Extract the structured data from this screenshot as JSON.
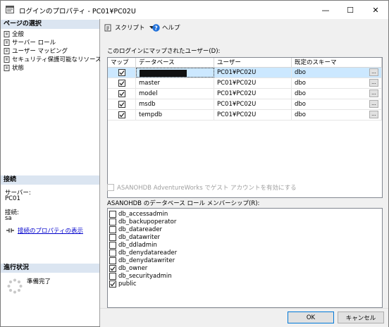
{
  "window": {
    "title": "ログインのプロパティ - PC01¥PC02U",
    "controls": {
      "minimize": "—",
      "maximize": "☐",
      "close": "✕"
    }
  },
  "sidebar": {
    "select_page_header": "ページの選択",
    "items": [
      {
        "label": "全般",
        "icon": "page-icon"
      },
      {
        "label": "サーバー ロール",
        "icon": "page-icon"
      },
      {
        "label": "ユーザー マッピング",
        "icon": "page-icon"
      },
      {
        "label": "セキュリティ保護可能なリソース",
        "icon": "page-icon"
      },
      {
        "label": "状態",
        "icon": "page-icon"
      }
    ],
    "connection_header": "接続",
    "server_label": "サーバー:",
    "server_value": "PC01",
    "connection_label": "接続:",
    "connection_value": "sa",
    "view_connection_link": "接続のプロパティの表示",
    "progress_header": "進行状況",
    "progress_status": "準備完了"
  },
  "toolbar": {
    "script_label": "スクリプト",
    "help_label": "ヘルプ"
  },
  "mapping": {
    "title": "このログインにマップされたユーザー(D):",
    "columns": [
      "マップ",
      "データベース",
      "ユーザー",
      "既定のスキーマ"
    ],
    "rows": [
      {
        "checked": true,
        "database": "",
        "redacted": true,
        "user": "PC01¥PC02U",
        "schema": "dbo",
        "selected": true
      },
      {
        "checked": true,
        "database": "master",
        "redacted": false,
        "user": "PC01¥PC02U",
        "schema": "dbo",
        "selected": false
      },
      {
        "checked": true,
        "database": "model",
        "redacted": false,
        "user": "PC01¥PC02U",
        "schema": "dbo",
        "selected": false
      },
      {
        "checked": true,
        "database": "msdb",
        "redacted": false,
        "user": "PC01¥PC02U",
        "schema": "dbo",
        "selected": false
      },
      {
        "checked": true,
        "database": "tempdb",
        "redacted": false,
        "user": "PC01¥PC02U",
        "schema": "dbo",
        "selected": false
      }
    ],
    "ellipsis": "..."
  },
  "guest_account": {
    "label": "ASANOHDB AdventureWorks でゲスト アカウントを有効にする",
    "checked": false,
    "enabled": false
  },
  "roles": {
    "title": "ASANOHDB のデータベース ロール メンバーシップ(R):",
    "items": [
      {
        "label": "db_accessadmin",
        "checked": false
      },
      {
        "label": "db_backupoperator",
        "checked": false
      },
      {
        "label": "db_datareader",
        "checked": false
      },
      {
        "label": "db_datawriter",
        "checked": false
      },
      {
        "label": "db_ddladmin",
        "checked": false
      },
      {
        "label": "db_denydatareader",
        "checked": false
      },
      {
        "label": "db_denydatawriter",
        "checked": false
      },
      {
        "label": "db_owner",
        "checked": true
      },
      {
        "label": "db_securityadmin",
        "checked": false
      },
      {
        "label": "public",
        "checked": true
      }
    ]
  },
  "buttons": {
    "ok": "OK",
    "cancel": "キャンセル"
  },
  "colors": {
    "selected_row": "#cce8ff",
    "section_header": "#dbe5f1",
    "link": "#0000cc",
    "help_icon": "#1e6fd9"
  }
}
